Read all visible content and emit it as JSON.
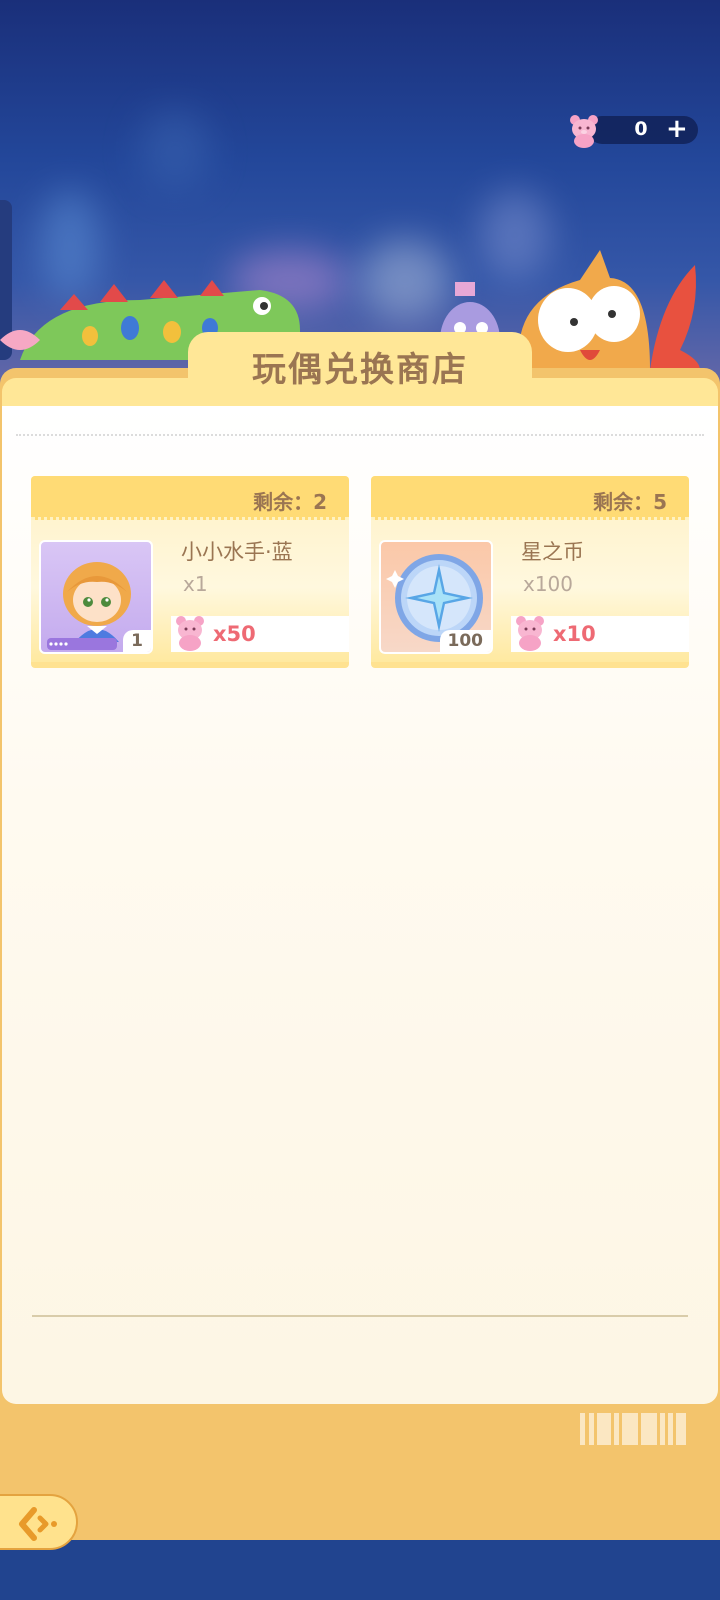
{
  "shop": {
    "title": "玩偶兑换商店"
  },
  "currency": {
    "icon": "pink-bear-token-icon",
    "amount": "0",
    "add_label": "+"
  },
  "items": [
    {
      "remaining": "剩余：2",
      "name": "小小水手·蓝",
      "amount": "x1",
      "thumb_qty": "1",
      "price": "x50",
      "icon": "sailor-doll-icon"
    },
    {
      "remaining": "剩余：5",
      "name": "星之币",
      "amount": "x100",
      "thumb_qty": "100",
      "price": "x10",
      "icon": "star-coin-icon"
    }
  ],
  "colors": {
    "panel": "#f3c46c",
    "tab": "#ffe797",
    "text_brown": "#9a7552",
    "price_pink": "#ee6a74"
  }
}
